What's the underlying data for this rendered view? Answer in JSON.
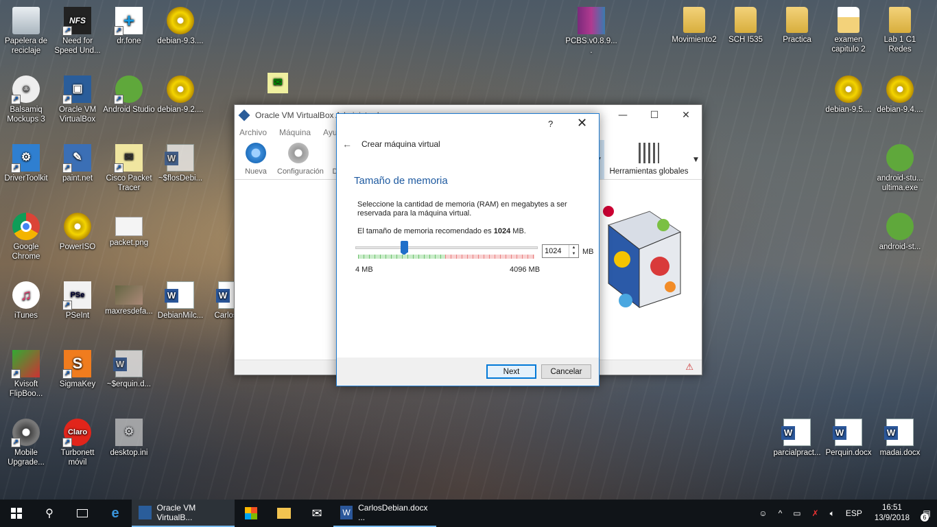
{
  "desktop": {
    "icons": {
      "recycle": "Papelera de reciclaje",
      "nfs": "Need for Speed Und...",
      "drfone": "dr.fone",
      "debian93": "debian-9.3....",
      "balsamiq": "Balsamiq Mockups 3",
      "vbox": "Oracle VM VirtualBox",
      "astudio": "Android Studio",
      "debian92": "debian-9.2....",
      "drivertoolkit": "DriverToolkit",
      "paintnet": "paint.net",
      "cisco": "Cisco Packet Tracer",
      "sflos": "~$flosDebi...",
      "chrome": "Google Chrome",
      "poweriso": "PowerISO",
      "packet": "packet.png",
      "itunes": "iTunes",
      "pseint": "PSeInt",
      "maxres": "maxresdefa...",
      "debianmilc": "DebianMilc...",
      "carlosd": "CarlosD...",
      "kvisoft": "Kvisoft FlipBoo...",
      "sigmakey": "SigmaKey",
      "serquin": "~$erquin.d...",
      "mobile": "Mobile Upgrade...",
      "turbonett": "Turbonett móvil",
      "desktopini": "desktop.ini",
      "pcbs": "PCBS.v0.8.9....",
      "movimiento2": "Movimiento2",
      "sch": "SCH I535",
      "practica": "Practica",
      "examen": "examen capitulo 2",
      "lab": "Lab 1 C1 Redes",
      "debian95": "debian-9.5....",
      "debian94": "debian-9.4....",
      "astudio_ultima": "android-stu... ultima.exe",
      "astudio2": "android-st...",
      "parcial": "parcialpract...",
      "perquin": "Perquin.docx",
      "madai": "madai.docx"
    }
  },
  "vbox_window": {
    "title": "Oracle VM VirtualBox Administrador",
    "menu": [
      "Archivo",
      "Máquina",
      "Ayuda"
    ],
    "toolbar": {
      "nueva": "Nueva",
      "configuracion": "Configuración",
      "descartar": "Desc",
      "herramientas": "Herramientas globales"
    }
  },
  "wizard": {
    "help": "?",
    "close": "✕",
    "back": "←",
    "title": "Crear máquina virtual",
    "heading": "Tamaño de memoria",
    "description": "Seleccione la cantidad de memoria (RAM) en megabytes a ser reservada para la máquina virtual.",
    "recommended_prefix": "El tamaño de memoria recomendado es",
    "recommended_value": "1024",
    "recommended_unit": "MB.",
    "memory_value": "1024",
    "memory_unit": "MB",
    "min_label": "4 MB",
    "max_label": "4096 MB",
    "slider_min": 4,
    "slider_max": 4096,
    "slider_value": 1024,
    "next_label": "Next",
    "cancel_label": "Cancelar"
  },
  "taskbar": {
    "vbox_task": "Oracle VM VirtualB...",
    "word_task": "CarlosDebian.docx ...",
    "language": "ESP",
    "time": "16:51",
    "date": "13/9/2018",
    "notifications": "6"
  }
}
